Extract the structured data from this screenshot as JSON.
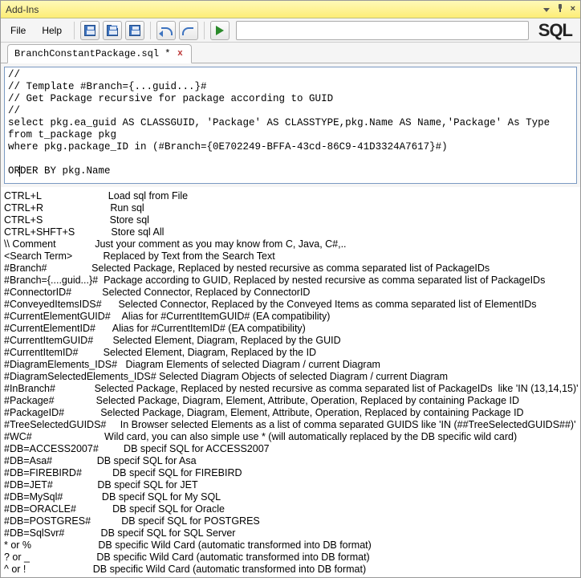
{
  "title": "Add-Ins",
  "menu": {
    "file": "File",
    "help": "Help"
  },
  "sql_tag": "SQL",
  "tab": {
    "label": "BranchConstantPackage.sql *"
  },
  "editor_lines": [
    "//",
    "// Template #Branch={...guid...}#",
    "// Get Package recursive for package according to GUID",
    "//",
    "select pkg.ea_guid AS CLASSGUID, 'Package' AS CLASSTYPE,pkg.Name AS Name,'Package' As Type",
    "from t_package pkg",
    "where pkg.package_ID in (#Branch={0E702249-BFFA-43cd-86C9-41D3324A7617}#)",
    "",
    "",
    ""
  ],
  "editor_last_line_prefix": "OR",
  "editor_last_line_suffix": "ER BY pkg.Name",
  "help": [
    [
      "CTRL+L",
      "Load sql from File"
    ],
    [
      "CTRL+R",
      "Run sql"
    ],
    [
      "CTRL+S",
      "Store sql"
    ],
    [
      "CTRL+SHFT+S",
      "Store sql All"
    ],
    [
      "\\\\ Comment",
      "Just your comment as you may know from C, Java, C#,.."
    ],
    [
      "<Search Term>",
      "Replaced by Text from the Search Text"
    ],
    [
      "#Branch#",
      "Selected Package, Replaced by nested recursive as comma separated list of PackageIDs"
    ],
    [
      "#Branch={....guid...}#",
      "Package according to GUID, Replaced by nested recursive as comma separated list of PackageIDs"
    ],
    [
      "#ConnectorID#",
      "Selected Connector, Replaced by ConnectorID"
    ],
    [
      "#ConveyedItemsIDS#",
      "Selected Connector, Replaced by the Conveyed Items as comma separated list of ElementIDs"
    ],
    [
      "#CurrentElementGUID#",
      "Alias for #CurrentItemGUID# (EA compatibility)"
    ],
    [
      "#CurrentElementID#",
      "Alias for #CurrentItemID# (EA compatibility)"
    ],
    [
      "#CurrentItemGUID#",
      "Selected Element, Diagram, Replaced by the GUID"
    ],
    [
      "#CurrentItemID#",
      "Selected Element, Diagram, Replaced by the ID"
    ],
    [
      "#DiagramElements_IDS#",
      "Diagram Elements of selected Diagram / current Diagram"
    ],
    [
      "#DiagramSelectedElements_IDS#",
      "Selected Diagram Objects of selected Diagram / current Diagram"
    ],
    [
      "#InBranch#",
      "Selected Package, Replaced by nested recursive as comma separated list of PackageIDs  like 'IN (13,14,15)'"
    ],
    [
      "#Package#",
      "Selected Package, Diagram, Element, Attribute, Operation, Replaced by containing Package ID"
    ],
    [
      "#PackageID#",
      "Selected Package, Diagram, Element, Attribute, Operation, Replaced by containing Package ID"
    ],
    [
      "#TreeSelectedGUIDS#",
      "In Browser selected Elements as a list of comma separated GUIDS like 'IN (##TreeSelectedGUIDS##)'"
    ],
    [
      "#WC#",
      "Wild card, you can also simple use * (will automatically replaced by the DB specific wild card)"
    ],
    [
      "#DB=ACCESS2007#",
      "DB specif SQL for ACCESS2007"
    ],
    [
      "#DB=Asa#",
      "DB specif SQL for Asa"
    ],
    [
      "#DB=FIREBIRD#",
      "DB specif SQL for FIREBIRD"
    ],
    [
      "#DB=JET#",
      "DB specif SQL for JET"
    ],
    [
      "#DB=MySql#",
      "DB specif SQL for My SQL"
    ],
    [
      "#DB=ORACLE#",
      "DB specif SQL for Oracle"
    ],
    [
      "#DB=POSTGRES#",
      "DB specif SQL for POSTGRES"
    ],
    [
      "#DB=SqlSvr#",
      "DB specif SQL for SQL Server"
    ],
    [
      "* or %",
      "DB specific Wild Card (automatic transformed into DB format)"
    ],
    [
      "? or _",
      "DB specific Wild Card (automatic transformed into DB format)"
    ],
    [
      "^ or !",
      "DB specific Wild Card (automatic transformed into DB format)"
    ]
  ]
}
